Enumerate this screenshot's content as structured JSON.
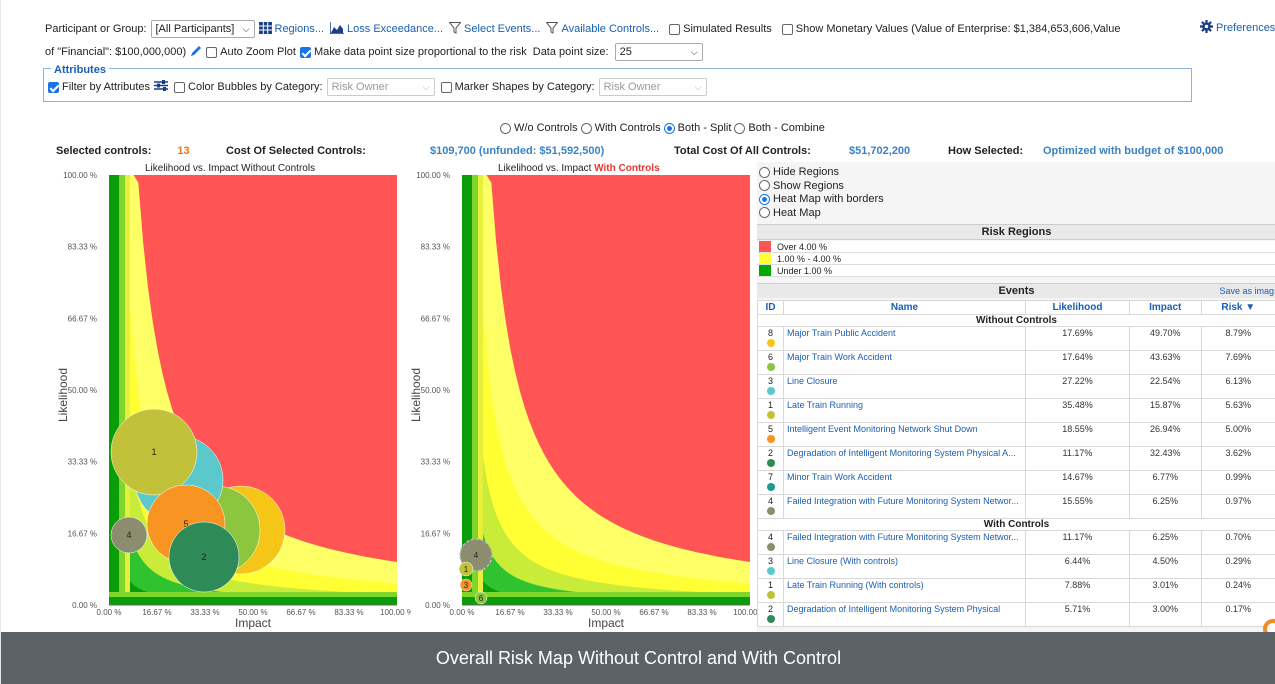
{
  "toolbar": {
    "participant_label": "Participant or Group:",
    "participant_value": "[All Participants]",
    "regions": "Regions...",
    "loss_exceedance": "Loss Exceedance...",
    "select_events": "Select Events...",
    "available_controls": "Available Controls...",
    "simulated_results": "Simulated Results",
    "show_monetary": "Show Monetary Values (Value of Enterprise: $1,384,653,606,Value",
    "show_monetary_cont": "of \"Financial\": $100,000,000)",
    "preferences": "Preferences",
    "auto_zoom": "Auto Zoom Plot",
    "proportional": "Make data point size proportional to the risk",
    "point_size_label": "Data point size:",
    "point_size_value": "25"
  },
  "attributes": {
    "title": "Attributes",
    "filter_label": "Filter by Attributes",
    "color_label": "Color Bubbles by Category:",
    "color_value": "Risk Owner",
    "marker_label": "Marker Shapes by Category:",
    "marker_value": "Risk Owner"
  },
  "view_modes": [
    "W/o Controls",
    "With Controls",
    "Both - Split",
    "Both - Combine"
  ],
  "summary": {
    "selected_controls_label": "Selected controls:",
    "selected_controls_value": "13",
    "cost_selected_label": "Cost Of Selected Controls:",
    "cost_selected_value": "$109,700 (unfunded: $51,592,500)",
    "total_cost_label": "Total Cost Of All Controls:",
    "total_cost_value": "$51,702,200",
    "how_selected_label": "How Selected:",
    "how_selected_value": "Optimized with budget of $100,000"
  },
  "charts": {
    "left_title": "Likelihood vs. Impact Without Controls",
    "right_title_prefix": "Likelihood vs. Impact",
    "right_title_suffix": "With Controls",
    "x_label": "Impact",
    "y_label": "Likelihood",
    "y_ticks": [
      "100.00 %",
      "83.33 %",
      "66.67 %",
      "50.00 %",
      "33.33 %",
      "16.67 %",
      "0.00 %"
    ],
    "x_ticks": [
      "0.00 %",
      "16.67 %",
      "33.33 %",
      "50.00 %",
      "66.67 %",
      "83.33 %",
      "100.00 %"
    ]
  },
  "region_opts": [
    "Hide Regions",
    "Show Regions",
    "Heat Map with borders",
    "Heat Map"
  ],
  "legend": {
    "title": "Risk Regions",
    "items": [
      {
        "label": "Over 4.00 %",
        "color": "#ff5555"
      },
      {
        "label": "1.00 % - 4.00 %",
        "color": "#ffff33"
      },
      {
        "label": "Under 1.00 %",
        "color": "#00aa00"
      }
    ]
  },
  "events": {
    "title": "Events",
    "save": "Save as imag",
    "headers": [
      "ID",
      "Name",
      "Likelihood",
      "Impact",
      "Risk ▼"
    ],
    "without_label": "Without Controls",
    "with_label": "With Controls",
    "without": [
      {
        "id": "8",
        "name": "Major Train Public Accident",
        "likelihood": "17.69%",
        "impact": "49.70%",
        "risk": "8.79%",
        "color": "#f5c518"
      },
      {
        "id": "6",
        "name": "Major Train Work Accident",
        "likelihood": "17.64%",
        "impact": "43.63%",
        "risk": "7.69%",
        "color": "#8cc63f"
      },
      {
        "id": "3",
        "name": "Line Closure",
        "likelihood": "27.22%",
        "impact": "22.54%",
        "risk": "6.13%",
        "color": "#5bc8cc"
      },
      {
        "id": "1",
        "name": "Late Train Running",
        "likelihood": "35.48%",
        "impact": "15.87%",
        "risk": "5.63%",
        "color": "#c2c23a"
      },
      {
        "id": "5",
        "name": "Intelligent Event Monitoring Network Shut Down",
        "likelihood": "18.55%",
        "impact": "26.94%",
        "risk": "5.00%",
        "color": "#f79422"
      },
      {
        "id": "2",
        "name": "Degradation of Intelligent Monitoring System Physical A...",
        "likelihood": "11.17%",
        "impact": "32.43%",
        "risk": "3.62%",
        "color": "#2e8b57"
      },
      {
        "id": "7",
        "name": "Minor Train Work Accident",
        "likelihood": "14.67%",
        "impact": "6.77%",
        "risk": "0.99%",
        "color": "#1e9a8a"
      },
      {
        "id": "4",
        "name": "Failed Integration with Future Monitoring System Networ...",
        "likelihood": "15.55%",
        "impact": "6.25%",
        "risk": "0.97%",
        "color": "#8c8c6e"
      }
    ],
    "with": [
      {
        "id": "4",
        "name": "Failed Integration with Future Monitoring System Networ...",
        "likelihood": "11.17%",
        "impact": "6.25%",
        "risk": "0.70%",
        "color": "#8c8c6e"
      },
      {
        "id": "3",
        "name": "Line Closure (With controls)",
        "likelihood": "6.44%",
        "impact": "4.50%",
        "risk": "0.29%",
        "color": "#5bc8cc"
      },
      {
        "id": "1",
        "name": "Late Train Running (With controls)",
        "likelihood": "7.88%",
        "impact": "3.01%",
        "risk": "0.24%",
        "color": "#c2c23a"
      },
      {
        "id": "2",
        "name": "Degradation of Intelligent Monitoring System Physical",
        "likelihood": "5.71%",
        "impact": "3.00%",
        "risk": "0.17%",
        "color": "#2e8b57"
      }
    ]
  },
  "bubbles_without": [
    {
      "id": "8",
      "color": "#f5c518"
    },
    {
      "id": "6",
      "color": "#8cc63f"
    },
    {
      "id": "3",
      "color": "#5bc8cc"
    },
    {
      "id": "1",
      "color": "#c2c23a"
    },
    {
      "id": "5",
      "color": "#f79422"
    },
    {
      "id": "2",
      "color": "#2e8b57"
    },
    {
      "id": "4",
      "color": "#8c8c6e"
    }
  ],
  "bubbles_with": [
    {
      "id": "4",
      "color": "#8c8c6e"
    },
    {
      "id": "1",
      "color": "#c2c23a"
    },
    {
      "id": "3",
      "color": "#f79422"
    },
    {
      "id": "6",
      "color": "#8cc63f"
    }
  ],
  "caption": "Overall Risk Map Without Control and With Control"
}
